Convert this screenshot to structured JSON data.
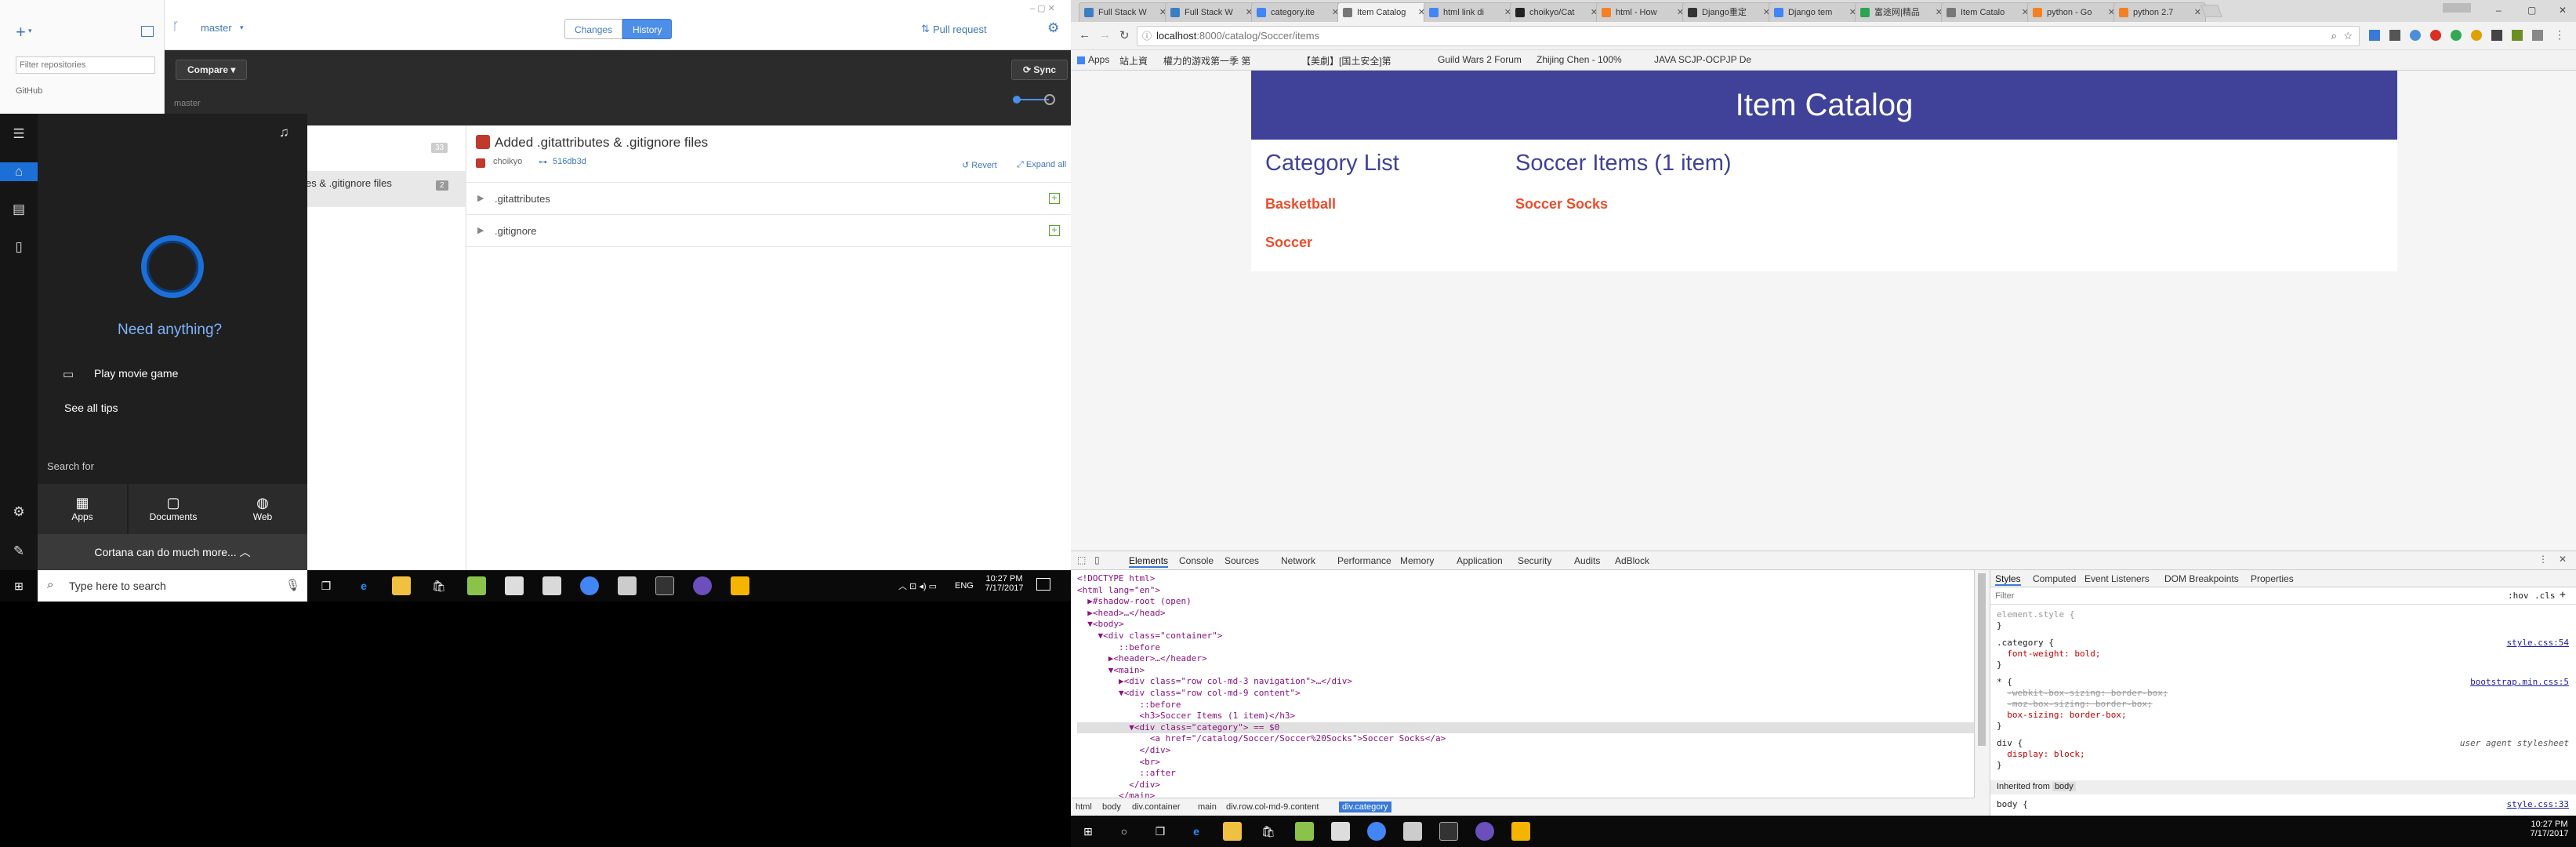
{
  "github": {
    "add_icon": "+",
    "branch_icon": "branch-icon",
    "branch": "master",
    "tabs": [
      "Changes",
      "History"
    ],
    "pull_request": "Pull request",
    "filter_placeholder": "Filter repositories",
    "repo_group": "GitHub",
    "compare_label": "Compare",
    "sync_label": "Sync",
    "branch_label": "master",
    "commit_count": "33",
    "commit_title_partial": "es & .gitignore files",
    "commit_files_count": "2",
    "commit": {
      "title": "Added .gitattributes & .gitignore files",
      "author": "choikyo",
      "sha": "516db3d",
      "revert": "Revert",
      "expand_all": "Expand all"
    },
    "files": [
      ".gitattributes",
      ".gitignore"
    ]
  },
  "cortana": {
    "prompt": "Need anything?",
    "items": [
      "Play movie game",
      "See all tips"
    ],
    "search_for": "Search for",
    "tiles": [
      "Apps",
      "Documents",
      "Web"
    ],
    "more": "Cortana can do much more...",
    "search_placeholder": "Type here to search"
  },
  "taskbar_left": {
    "lang": "ENG",
    "time": "10:27 PM",
    "date": "7/17/2017"
  },
  "taskbar_right": {
    "time": "10:27 PM",
    "date": "7/17/2017"
  },
  "chrome": {
    "tabs": [
      {
        "label": "Full Stack W",
        "color": "#3d7ec2"
      },
      {
        "label": "Full Stack W",
        "color": "#3d7ec2"
      },
      {
        "label": "category.ite",
        "color": "#4285f4"
      },
      {
        "label": "Item Catalog",
        "color": "#777777"
      },
      {
        "label": "html link di",
        "color": "#4285f4"
      },
      {
        "label": "choikyo/Cat",
        "color": "#222222"
      },
      {
        "label": "html - How",
        "color": "#f48024"
      },
      {
        "label": "Django重定",
        "color": "#333333"
      },
      {
        "label": "Django tem",
        "color": "#4285f4"
      },
      {
        "label": "富途网|精品",
        "color": "#2da44e"
      },
      {
        "label": "Item Catalo",
        "color": "#777777"
      },
      {
        "label": "python - Go",
        "color": "#f48024"
      },
      {
        "label": "python 2.7",
        "color": "#f48024"
      }
    ],
    "active_tab": 3,
    "url_host": "localhost",
    "url_path": ":8000/catalog/Soccer/items",
    "bookmarks": [
      "Apps",
      "站上資",
      "權力的游戏第一季 第",
      "【美劇】[国土安全]第",
      "Guild Wars 2 Forum",
      "Zhijing Chen - 100%",
      "JAVA SCJP-OCPJP De"
    ],
    "page": {
      "header": "Item Catalog",
      "category_heading": "Category List",
      "items_heading": "Soccer Items (1 item)",
      "categories": [
        "Basketball",
        "Soccer"
      ],
      "items": [
        "Soccer Socks"
      ]
    },
    "devtools": {
      "tabs": [
        "Elements",
        "Console",
        "Sources",
        "Network",
        "Performance",
        "Memory",
        "Application",
        "Security",
        "Audits",
        "AdBlock"
      ],
      "dom": [
        "<!DOCTYPE html>",
        "<html lang=\"en\">",
        "  ▶#shadow-root (open)",
        "  ▶<head>…</head>",
        "  ▼<body>",
        "    ▼<div class=\"container\">",
        "        ::before",
        "      ▶<header>…</header>",
        "      ▼<main>",
        "        ▶<div class=\"row col-md-3 navigation\">…</div>",
        "        ▼<div class=\"row col-md-9 content\">",
        "            ::before",
        "            <h3>Soccer Items (1 item)</h3>",
        "          ▼<div class=\"category\"> == $0",
        "              <a href=\"/catalog/Soccer/Soccer%20Socks\">Soccer Socks</a>",
        "            </div>",
        "            <br>",
        "            ::after",
        "          </div>",
        "        </main>"
      ],
      "selected_line": 13,
      "breadcrumbs": [
        "html",
        "body",
        "div.container",
        "main",
        "div.row.col-md-9.content",
        "div.category"
      ],
      "styles_tabs": [
        "Styles",
        "Computed",
        "Event Listeners",
        "DOM Breakpoints",
        "Properties"
      ],
      "filter_placeholder": "Filter",
      "hov": ":hov",
      "cls": ".cls",
      "rules": {
        "element": "element.style {",
        "category_sel": ".category {",
        "category_prop": "font-weight: bold;",
        "category_src": "style.css:54",
        "bs_sel": "* {",
        "bs_src": "bootstrap.min.css:5",
        "bs_p1": "-webkit-box-sizing: border-box;",
        "bs_p2": "-moz-box-sizing: border-box;",
        "bs_p3": "box-sizing: border-box;",
        "div_sel": "div {",
        "div_src": "user agent stylesheet",
        "div_prop": "display: block;",
        "inherited": "Inherited from",
        "inherited_el": "body",
        "body_sel": "body {",
        "body_src": "style.css:33"
      }
    }
  }
}
